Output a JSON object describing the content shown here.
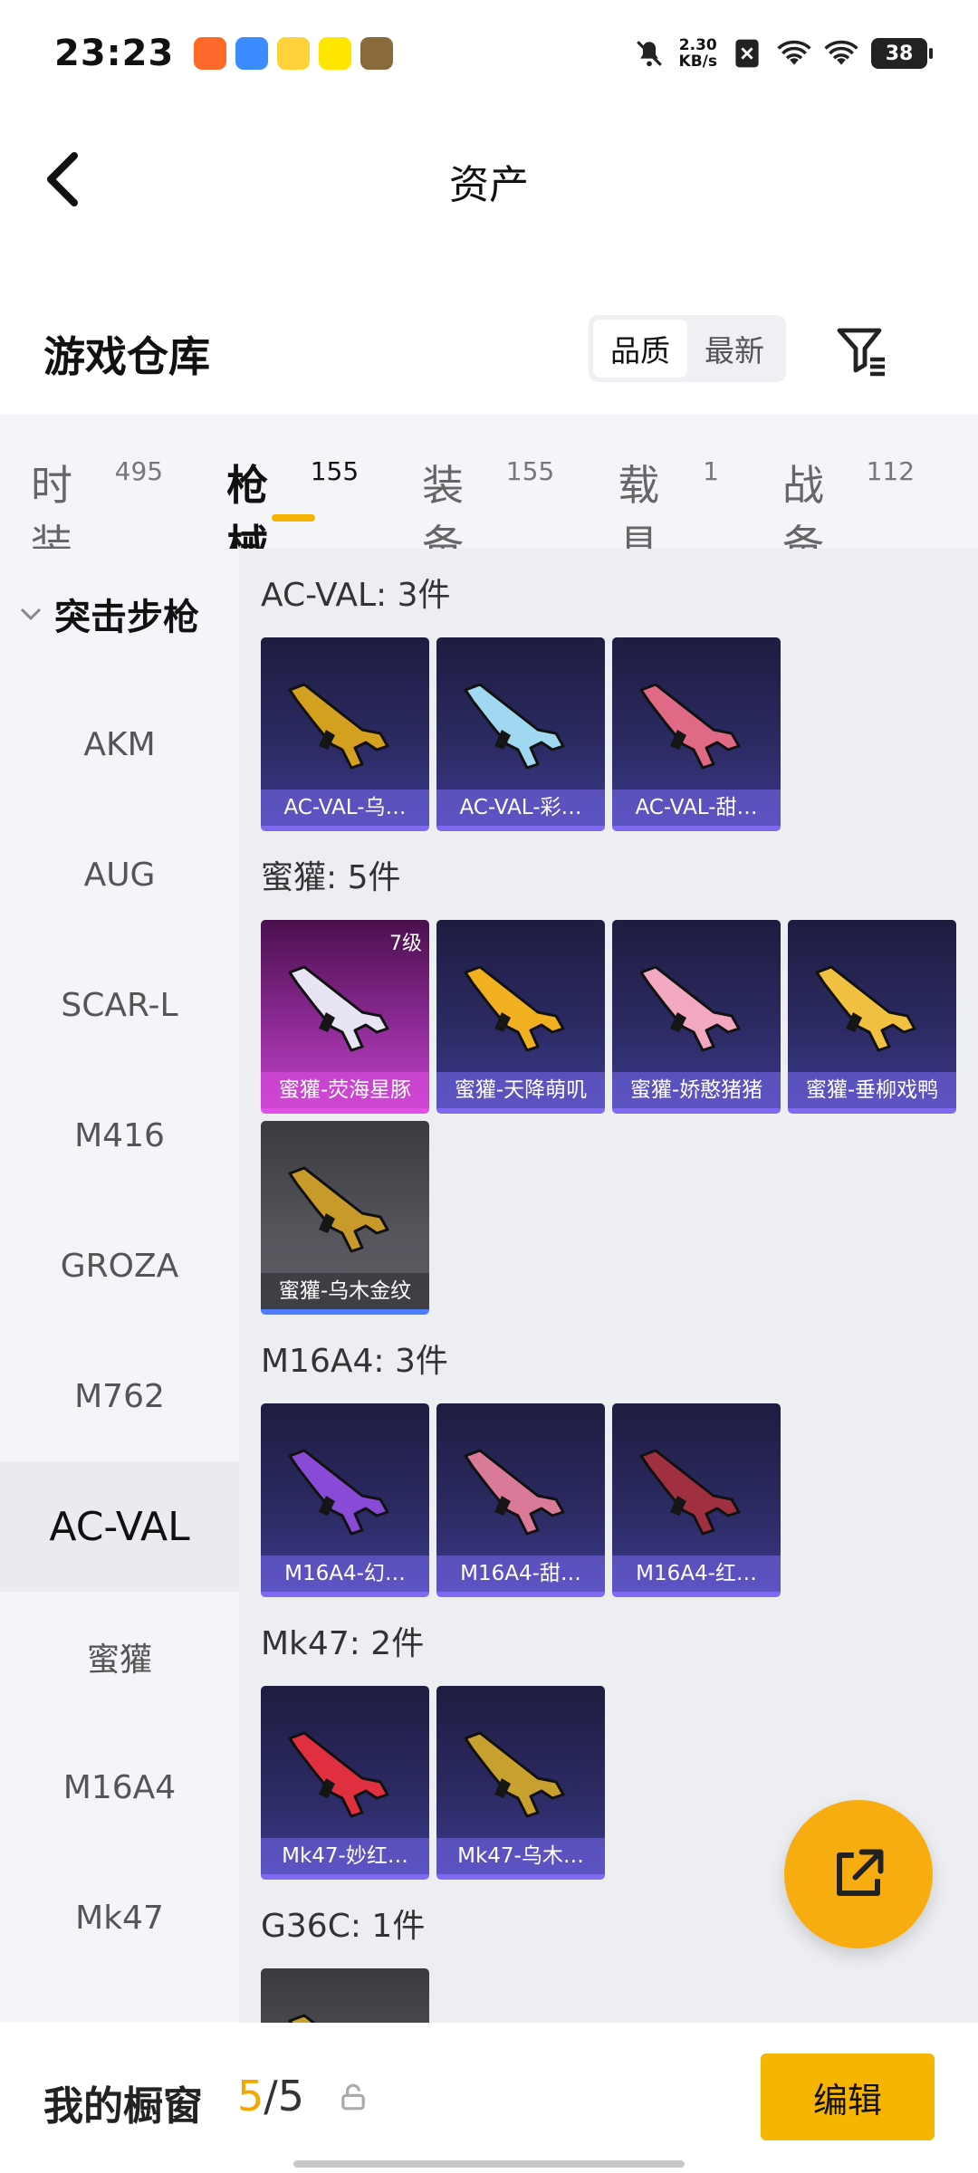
{
  "status_bar": {
    "time": "23:23",
    "net_speed_value": "2.30",
    "net_speed_unit": "KB/s",
    "battery": "38"
  },
  "nav": {
    "title": "资产"
  },
  "repo": {
    "title": "游戏仓库",
    "sort_options": [
      "品质",
      "最新"
    ]
  },
  "category_tabs": [
    {
      "label": "时装",
      "count": "495"
    },
    {
      "label": "枪械",
      "count": "155"
    },
    {
      "label": "装备",
      "count": "155"
    },
    {
      "label": "载具",
      "count": "1"
    },
    {
      "label": "战备",
      "count": "112"
    }
  ],
  "sidebar": {
    "group": "突击步枪",
    "items": [
      "AKM",
      "AUG",
      "SCAR-L",
      "M416",
      "GROZA",
      "M762",
      "AC-VAL",
      "蜜獾",
      "M16A4",
      "Mk47"
    ],
    "active": "AC-VAL"
  },
  "groups": [
    {
      "title": "AC-VAL: 3件",
      "items": [
        {
          "name": "AC-VAL-乌…",
          "style": "purple",
          "gun_color": "#d4a020"
        },
        {
          "name": "AC-VAL-彩…",
          "style": "purple",
          "gun_color": "#9fd8f0"
        },
        {
          "name": "AC-VAL-甜…",
          "style": "purple",
          "gun_color": "#e06a86"
        }
      ]
    },
    {
      "title": "蜜獾: 5件",
      "items": [
        {
          "name": "蜜獾-荧海星豚",
          "style": "pink",
          "gun_color": "#e8e4f4",
          "level": "7级"
        },
        {
          "name": "蜜獾-天降萌叽",
          "style": "purple",
          "gun_color": "#f0b020"
        },
        {
          "name": "蜜獾-娇憨猪猪",
          "style": "purple",
          "gun_color": "#f2a8c0"
        },
        {
          "name": "蜜獾-垂柳戏鸭",
          "style": "purple",
          "gun_color": "#f0c040"
        },
        {
          "name": "蜜獾-乌木金纹",
          "style": "grey",
          "gun_color": "#c89a2a"
        }
      ]
    },
    {
      "title": "M16A4: 3件",
      "items": [
        {
          "name": "M16A4-幻…",
          "style": "purple",
          "gun_color": "#8a4ad8"
        },
        {
          "name": "M16A4-甜…",
          "style": "purple",
          "gun_color": "#d87a98"
        },
        {
          "name": "M16A4-红…",
          "style": "purple",
          "gun_color": "#a03040"
        }
      ]
    },
    {
      "title": "Mk47: 2件",
      "items": [
        {
          "name": "Mk47-妙红…",
          "style": "purple",
          "gun_color": "#e03040"
        },
        {
          "name": "Mk47-乌木…",
          "style": "purple",
          "gun_color": "#c8a030"
        }
      ]
    },
    {
      "title": "G36C: 1件",
      "items": [
        {
          "name": "",
          "style": "grey",
          "gun_color": "#c8a030"
        }
      ]
    }
  ],
  "showcase": {
    "label": "我的橱窗",
    "current": "5",
    "total": "5"
  },
  "edit_button": "编辑",
  "colors": {
    "accent": "#f7b500",
    "card_purple": "#2b2a62"
  }
}
